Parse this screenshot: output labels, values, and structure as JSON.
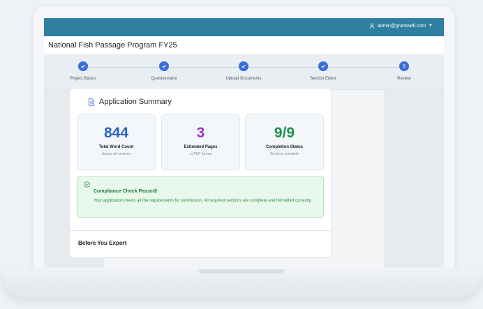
{
  "header": {
    "user_email": "admin@grantwell.com"
  },
  "page": {
    "title": "National Fish Passage Program FY25"
  },
  "steps": [
    {
      "label": "Project Basics",
      "state": "complete",
      "number": "1"
    },
    {
      "label": "Questionnaire",
      "state": "complete",
      "number": "2"
    },
    {
      "label": "Upload Documents",
      "state": "complete",
      "number": "3"
    },
    {
      "label": "Section Editor",
      "state": "complete",
      "number": "4"
    },
    {
      "label": "Review",
      "state": "current",
      "number": "5"
    }
  ],
  "summary": {
    "title": "Application Summary",
    "stats": [
      {
        "value": "844",
        "label": "Total Word Count",
        "sub": "Across all sections",
        "color": "#2a62c6"
      },
      {
        "value": "3",
        "label": "Estimated Pages",
        "sub": "in PDF format",
        "color": "#9b33cf"
      },
      {
        "value": "9/9",
        "label": "Completion Status",
        "sub": "Sections complete",
        "color": "#1f8f4c"
      }
    ],
    "compliance_title": "Compliance Check Passed!",
    "compliance_message": "Your application meets all the requirements for submission. All required sections are complete and formatted correctly."
  },
  "export": {
    "title": "Before You Export"
  },
  "colors": {
    "topbar": "#2f7fa1",
    "step": "#3b6fd6"
  }
}
